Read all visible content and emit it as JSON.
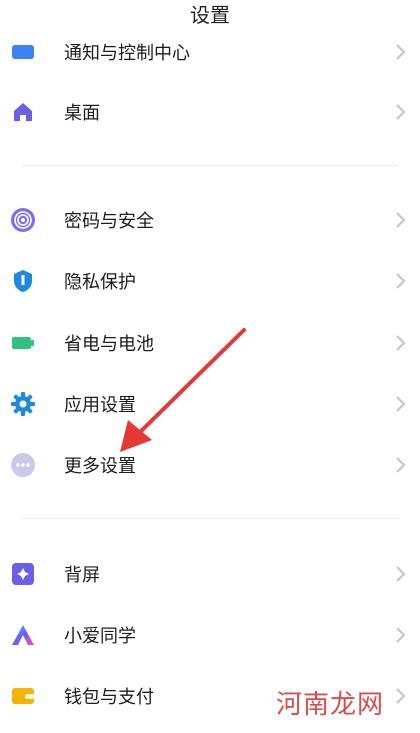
{
  "header": {
    "title": "设置"
  },
  "items": [
    {
      "label": "通知与控制中心",
      "icon": "notification-icon",
      "color": "#3b82f6"
    },
    {
      "label": "桌面",
      "icon": "home-icon",
      "color": "#6b5fe6"
    },
    {
      "label": "密码与安全",
      "icon": "fingerprint-icon",
      "color": "#7c6ff0"
    },
    {
      "label": "隐私保护",
      "icon": "privacy-shield-icon",
      "color": "#1e88e5"
    },
    {
      "label": "省电与电池",
      "icon": "battery-icon",
      "color": "#2ec27e"
    },
    {
      "label": "应用设置",
      "icon": "gear-icon",
      "color": "#1e88e5"
    },
    {
      "label": "更多设置",
      "icon": "more-dots-icon",
      "color": "#c7cbe9"
    },
    {
      "label": "背屏",
      "icon": "back-screen-icon",
      "color": "#6b5fe6"
    },
    {
      "label": "小爱同学",
      "icon": "xiaoai-icon",
      "color": "#6a5cff"
    },
    {
      "label": "钱包与支付",
      "icon": "wallet-icon",
      "color": "#f4b400"
    }
  ],
  "annotation": {
    "arrow_color": "#e53935"
  },
  "watermark": "河南龙网"
}
